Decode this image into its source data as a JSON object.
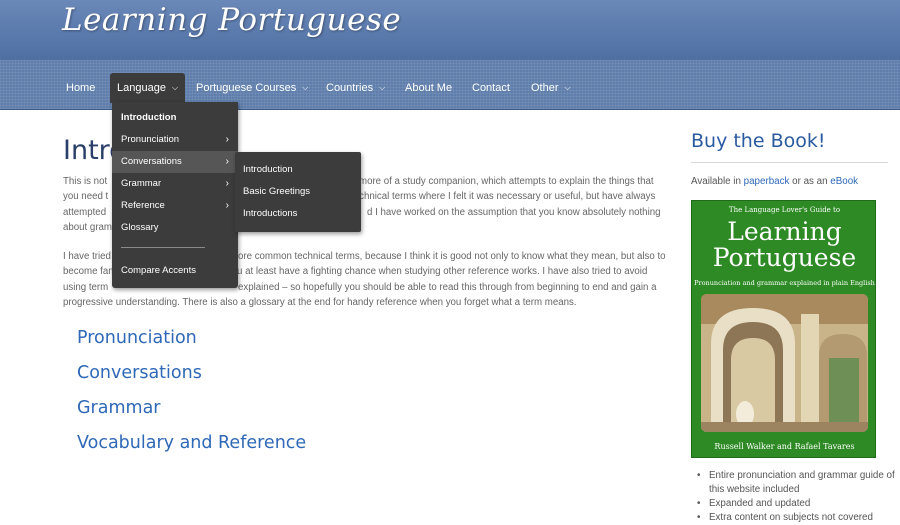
{
  "site": {
    "logo": "Learning Portuguese"
  },
  "nav": {
    "items": [
      {
        "label": "Home"
      },
      {
        "label": "Language"
      },
      {
        "label": "Portuguese Courses"
      },
      {
        "label": "Countries"
      },
      {
        "label": "About Me"
      },
      {
        "label": "Contact"
      },
      {
        "label": "Other"
      }
    ]
  },
  "language_menu": {
    "items": [
      {
        "label": "Introduction"
      },
      {
        "label": "Pronunciation"
      },
      {
        "label": "Conversations"
      },
      {
        "label": "Grammar"
      },
      {
        "label": "Reference"
      },
      {
        "label": "Glossary"
      },
      {
        "label": "Compare Accents"
      }
    ]
  },
  "conversations_menu": {
    "items": [
      {
        "label": "Introduction"
      },
      {
        "label": "Basic Greetings"
      },
      {
        "label": "Introductions"
      }
    ]
  },
  "main": {
    "title": "Intro",
    "paragraph1_lines": [
      "This is not",
      "you need t",
      "attempted",
      "about gram"
    ],
    "paragraph1_right_lines": [
      "more of a study companion, which attempts to explain the things that",
      "d technical terms where I felt it was necessary or useful, but have always",
      "d I have worked on the assumption that you know absolutely nothing"
    ],
    "paragraph2_lines": [
      "I have tried",
      "become fam",
      "using term",
      "progressive understanding. There is also a glossary at the end for handy reference when you forget what a term means."
    ],
    "paragraph2_right_lines": [
      "ore common technical terms, because I think it is good not only to know what they mean, but also to",
      "u at least have a fighting chance when studying other reference works. I have also tried to avoid",
      "explained – so hopefully you should be able to read this through from beginning to end and gain a"
    ],
    "sections": [
      {
        "label": "Pronunciation"
      },
      {
        "label": "Conversations"
      },
      {
        "label": "Grammar"
      },
      {
        "label": "Vocabulary and Reference"
      }
    ]
  },
  "sidebar": {
    "title": "Buy the Book!",
    "available_prefix": "Available in ",
    "paperback_link": "paperback",
    "available_middle": " or as an ",
    "ebook_link": "eBook",
    "book_cover": {
      "top_line": "The Language Lover's Guide to",
      "title_line1": "Learning",
      "title_line2": "Portuguese",
      "subtitle": "Pronunciation and grammar explained in plain English",
      "authors": "Russell Walker and Rafael Tavares"
    },
    "features": [
      "Entire pronunciation and grammar guide of this website included",
      "Expanded and updated",
      "Extra content on subjects not covered"
    ]
  },
  "colors": {
    "header": "#5a78a8",
    "menu_bg": "#3c3c3c",
    "link": "#2e68b7",
    "book_green": "#2d8a24"
  }
}
